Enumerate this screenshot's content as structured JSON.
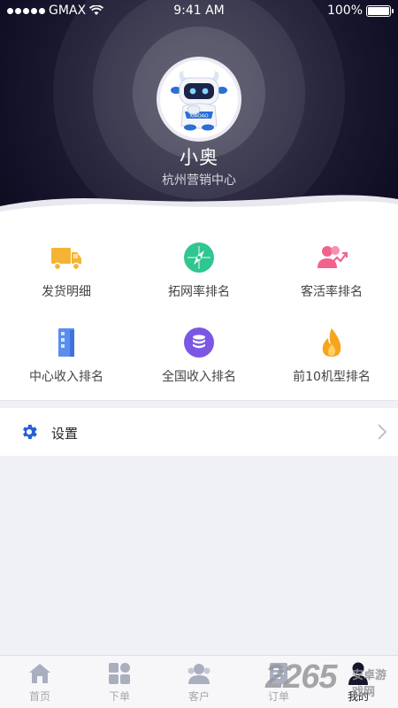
{
  "status_bar": {
    "carrier": "GMAX",
    "time": "9:41 AM",
    "battery": "100%"
  },
  "profile": {
    "name": "小奥",
    "org": "杭州营销中心"
  },
  "grid": [
    {
      "label": "发货明细",
      "icon": "truck-icon",
      "color": "#f5b335"
    },
    {
      "label": "拓网率排名",
      "icon": "compass-icon",
      "color": "#2fc68f"
    },
    {
      "label": "客活率排名",
      "icon": "users-trend-icon",
      "color": "#f3628c"
    },
    {
      "label": "中心收入排名",
      "icon": "building-icon",
      "color": "#5b8cf0"
    },
    {
      "label": "全国收入排名",
      "icon": "database-icon",
      "color": "#7a58e3"
    },
    {
      "label": "前10机型排名",
      "icon": "flame-icon",
      "color": "#f7a51c"
    }
  ],
  "settings": {
    "label": "设置",
    "icon": "gear-icon",
    "accent": "#2560d8"
  },
  "tabs": [
    {
      "label": "首页",
      "icon": "home-icon"
    },
    {
      "label": "下单",
      "icon": "grid-icon"
    },
    {
      "label": "客户",
      "icon": "customers-icon"
    },
    {
      "label": "订单",
      "icon": "orders-icon"
    },
    {
      "label": "我的",
      "icon": "profile-icon",
      "active": true
    }
  ],
  "watermark": {
    "number": "2265",
    "text": "安卓游戏网"
  }
}
